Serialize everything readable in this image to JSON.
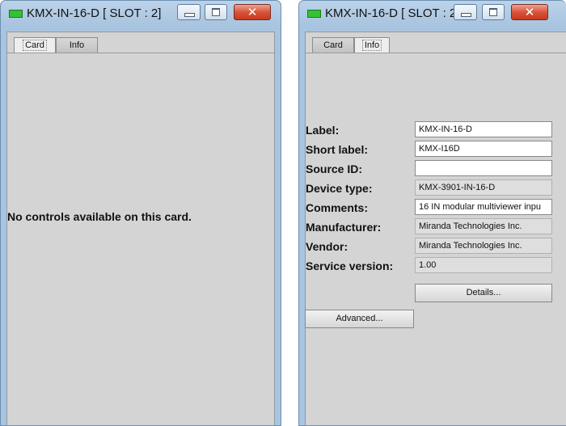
{
  "window_left": {
    "title": "KMX-IN-16-D [ SLOT : 2]",
    "tabs": [
      {
        "label": "Card",
        "active": true
      },
      {
        "label": "Info",
        "active": false
      }
    ],
    "message": "No controls available on this card."
  },
  "window_right": {
    "title": "KMX-IN-16-D [ SLOT : 2]",
    "tabs": [
      {
        "label": "Card",
        "active": false
      },
      {
        "label": "Info",
        "active": true
      }
    ],
    "fields": [
      {
        "label": "Label:",
        "value": "KMX-IN-16-D",
        "editable": true
      },
      {
        "label": "Short label:",
        "value": "KMX-I16D",
        "editable": true
      },
      {
        "label": "Source ID:",
        "value": "",
        "editable": true
      },
      {
        "label": "Device type:",
        "value": "KMX-3901-IN-16-D",
        "editable": false
      },
      {
        "label": "Comments:",
        "value": "16 IN modular multiviewer inpu",
        "editable": true
      },
      {
        "label": "Manufacturer:",
        "value": "Miranda Technologies Inc.",
        "editable": false
      },
      {
        "label": "Vendor:",
        "value": "Miranda Technologies Inc.",
        "editable": false
      },
      {
        "label": "Service version:",
        "value": "1.00",
        "editable": false
      }
    ],
    "details_button": "Details...",
    "advanced_button": "Advanced..."
  },
  "icons": {
    "app": "green-module-icon",
    "minimize": "minimize-icon",
    "maximize": "maximize-icon",
    "close": "close-icon"
  },
  "colors": {
    "titlebar": "#a9c4df",
    "panel": "#d4d4d4",
    "close_button": "#c7381f",
    "app_icon": "#33c233"
  }
}
